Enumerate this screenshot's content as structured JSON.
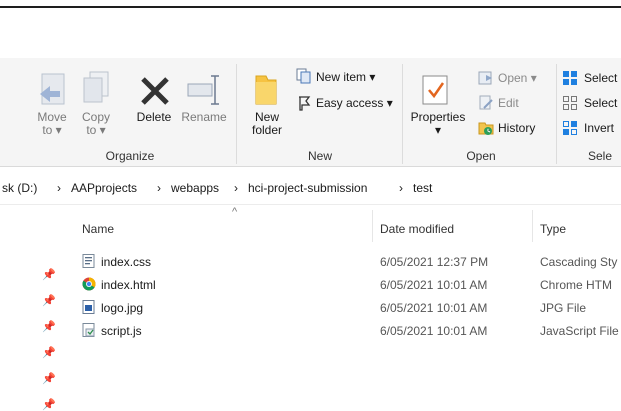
{
  "ribbon": {
    "organize": {
      "label": "Organize",
      "move_to": {
        "line1": "Move",
        "line2": "to ▾"
      },
      "copy_to": {
        "line1": "Copy",
        "line2": "to ▾"
      },
      "delete": "Delete",
      "rename": "Rename"
    },
    "new": {
      "label": "New",
      "new_folder": {
        "line1": "New",
        "line2": "folder"
      },
      "new_item": "New item ▾",
      "easy_access": "Easy access ▾"
    },
    "open": {
      "label": "Open",
      "properties": {
        "line1": "Properties",
        "line2": "▾"
      },
      "open": "Open ▾",
      "edit": "Edit",
      "history": "History"
    },
    "select": {
      "label": "Sele",
      "select_all": "Select",
      "select_none": "Select",
      "invert": "Invert"
    }
  },
  "breadcrumb": {
    "drive": "sk (D:)",
    "sep": "›",
    "items": [
      "AAPprojects",
      "webapps",
      "hci-project-submission",
      "test"
    ]
  },
  "columns": {
    "sort_arrow": "^",
    "name": "Name",
    "date": "Date modified",
    "type": "Type"
  },
  "files": [
    {
      "name": "index.css",
      "date": "6/05/2021 12:37 PM",
      "type": "Cascading Sty",
      "icon": "css-file-icon"
    },
    {
      "name": "index.html",
      "date": "6/05/2021 10:01 AM",
      "type": "Chrome HTM",
      "icon": "chrome-icon"
    },
    {
      "name": "logo.jpg",
      "date": "6/05/2021 10:01 AM",
      "type": "JPG File",
      "icon": "image-file-icon"
    },
    {
      "name": "script.js",
      "date": "6/05/2021 10:01 AM",
      "type": "JavaScript File",
      "icon": "js-file-icon"
    }
  ],
  "pins": [
    "📌",
    "📌",
    "📌",
    "📌",
    "📌",
    "📌"
  ],
  "colors": {
    "accent": "#0078d7",
    "folder": "#f6c342",
    "delete": "#333333"
  }
}
